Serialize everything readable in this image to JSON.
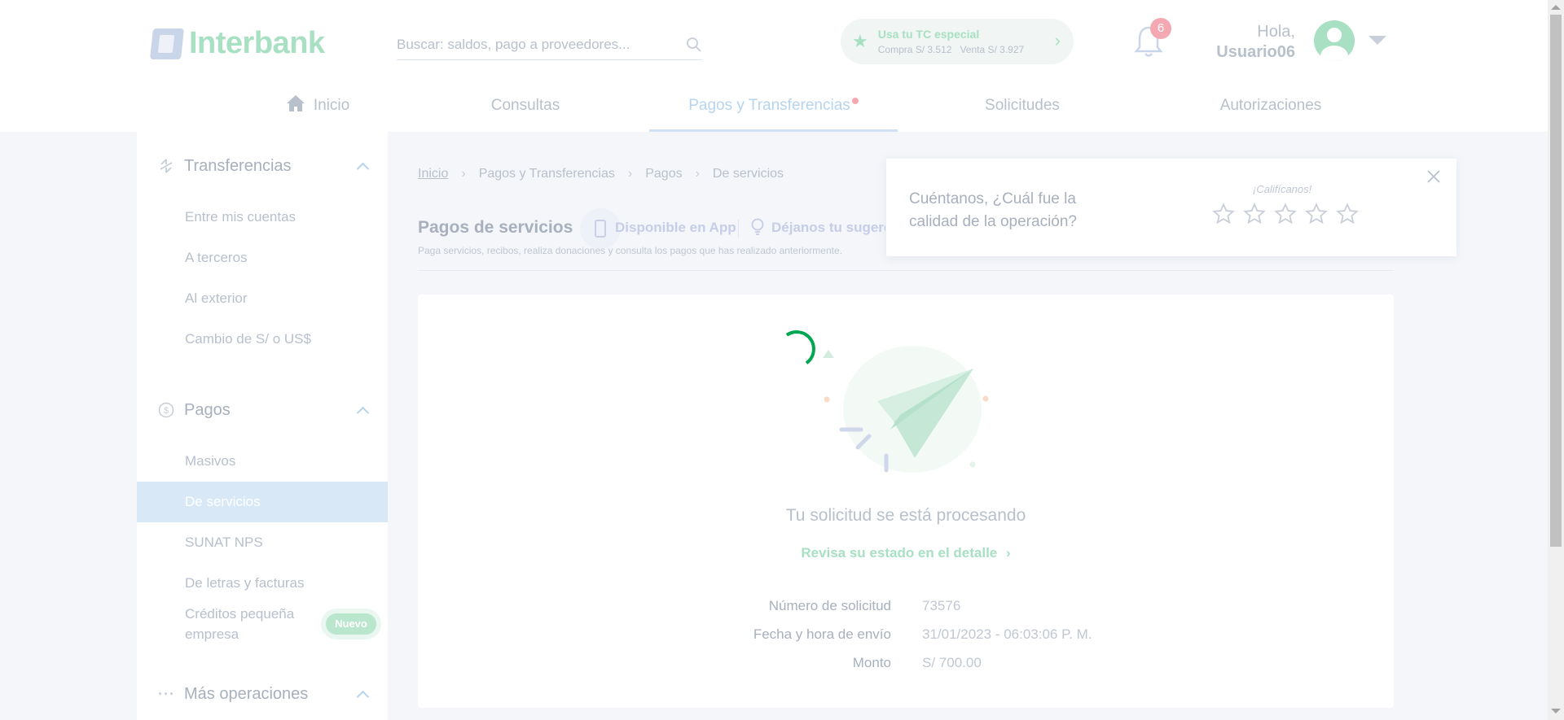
{
  "header": {
    "brand": "Interbank",
    "search_placeholder": "Buscar: saldos, pago a proveedores...",
    "tc": {
      "title": "Usa tu TC especial",
      "compra": "Compra S/ 3.512",
      "venta": "Venta S/ 3.927"
    },
    "notifications_count": "6",
    "greeting": "Hola,",
    "username": "Usuario06"
  },
  "nav": {
    "items": [
      {
        "label": "Inicio"
      },
      {
        "label": "Consultas"
      },
      {
        "label": "Pagos y Transferencias"
      },
      {
        "label": "Solicitudes"
      },
      {
        "label": "Autorizaciones"
      }
    ]
  },
  "sidebar": {
    "sections": [
      {
        "label": "Transferencias",
        "icon": "transfer-icon"
      },
      {
        "label": "Pagos",
        "icon": "dollar-circle-icon"
      },
      {
        "label": "Más operaciones",
        "icon": "more-icon"
      }
    ],
    "transfer_items": [
      "Entre mis cuentas",
      "A terceros",
      "Al exterior",
      "Cambio de S/ o US$"
    ],
    "pagos_items": [
      "Masivos",
      "De servicios",
      "SUNAT NPS",
      "De letras y facturas",
      "Créditos pequeña empresa"
    ],
    "badge_nuevo": "Nuevo"
  },
  "breadcrumb": [
    "Inicio",
    "Pagos y Transferencias",
    "Pagos",
    "De servicios"
  ],
  "page": {
    "title": "Pagos de servicios",
    "app_label": "Disponible en App",
    "suggestion_label": "Déjanos tu sugerencia",
    "description": "Paga servicios, recibos, realiza donaciones y consulta los pagos que has realizado anteriormente."
  },
  "status": {
    "title": "Tu solicitud se está procesando",
    "link": "Revisa su estado en el detalle",
    "details": [
      {
        "label": "Número de solicitud",
        "value": "73576"
      },
      {
        "label": "Fecha y hora de envío",
        "value": "31/01/2023 - 06:03:06 P. M."
      },
      {
        "label": "Monto",
        "value": "S/ 700.00"
      }
    ]
  },
  "rating": {
    "question": "Cuéntanos, ¿Cuál fue la calidad de la operación?",
    "label": "¡Califícanos!",
    "stars": 5
  },
  "colors": {
    "brand_green": "#00a651",
    "active_blue": "#d8e8f7",
    "badge_pink": "#f4a8b2"
  }
}
